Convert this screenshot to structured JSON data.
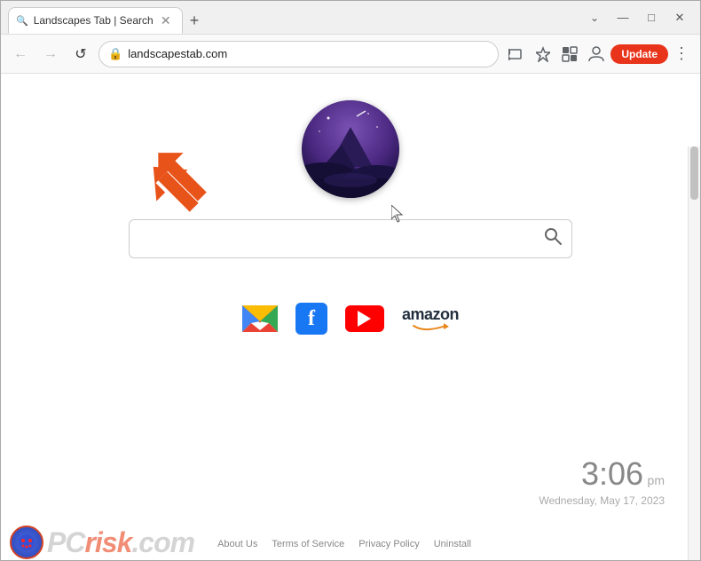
{
  "browser": {
    "tab": {
      "title": "Landscapes Tab | Search",
      "favicon": "🔍"
    },
    "new_tab_label": "+",
    "address": "landscapestab.com",
    "controls": {
      "minimize": "—",
      "maximize": "□",
      "close": "✕",
      "chevron_down": "⌄"
    },
    "nav": {
      "back": "←",
      "forward": "→",
      "reload": "↺"
    },
    "toolbar_icons": {
      "cast": "⬡",
      "star": "☆",
      "extensions": "◧",
      "profile": "○"
    },
    "update_button": "Update",
    "menu_dots": "⋮"
  },
  "page": {
    "search_placeholder": "",
    "search_icon": "🔍",
    "shortcuts": [
      {
        "name": "Gmail",
        "label": "gmail-icon"
      },
      {
        "name": "Facebook",
        "label": "f"
      },
      {
        "name": "YouTube",
        "label": "youtube-icon"
      },
      {
        "name": "Amazon",
        "label": "amazon",
        "arrow": "~"
      }
    ],
    "clock": {
      "time": "3:06",
      "period": "pm",
      "date": "Wednesday, May 17, 2023"
    },
    "footer_links": [
      "About Us",
      "Terms of Service",
      "Privacy Policy",
      "Uninstall"
    ]
  }
}
